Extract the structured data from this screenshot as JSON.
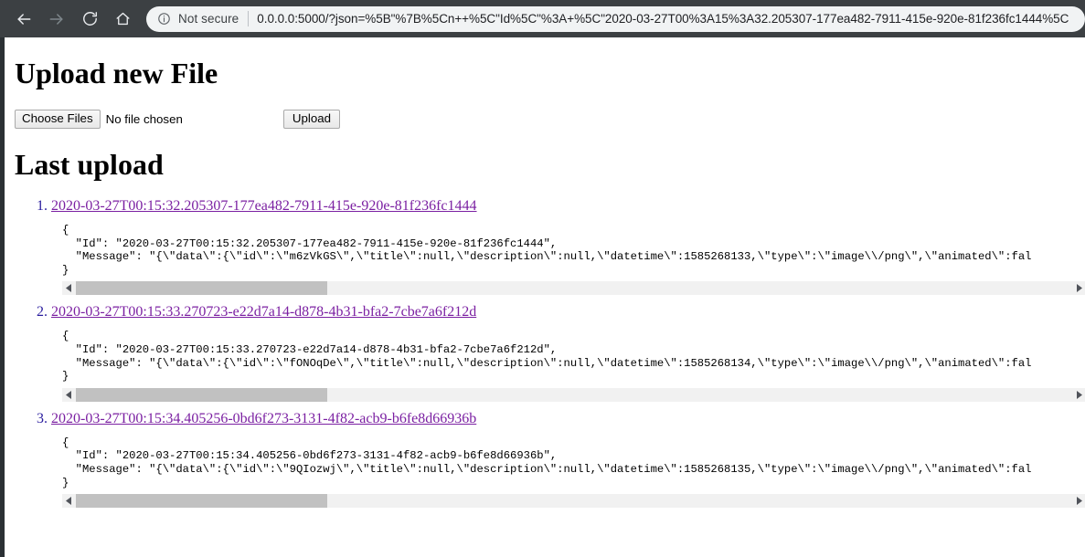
{
  "browser": {
    "back_icon": "back-arrow-icon",
    "forward_icon": "forward-arrow-icon",
    "reload_icon": "reload-icon",
    "home_icon": "home-icon",
    "info_icon": "info-circle-icon",
    "security_label": "Not secure",
    "url": "0.0.0.0:5000/?json=%5B\"%7B%5Cn++%5C\"Id%5C\"%3A+%5C\"2020-03-27T00%3A15%3A32.205307-177ea482-7911-415e-920e-81f236fc1444%5C",
    "chrome_bg": "#3c4043",
    "omnibox_bg": "#f1f3f4"
  },
  "page": {
    "title": "Upload new File",
    "section_title": "Last upload",
    "form": {
      "choose_files_label": "Choose Files",
      "no_file_label": "No file chosen",
      "upload_label": "Upload"
    },
    "link_color": "#7b20a2",
    "uploads": [
      {
        "link": "2020-03-27T00:15:32.205307-177ea482-7911-415e-920e-81f236fc1444",
        "code": "{\n  \"Id\": \"2020-03-27T00:15:32.205307-177ea482-7911-415e-920e-81f236fc1444\",\n  \"Message\": \"{\\\"data\\\":{\\\"id\\\":\\\"m6zVkGS\\\",\\\"title\\\":null,\\\"description\\\":null,\\\"datetime\\\":1585268133,\\\"type\\\":\\\"image\\\\/png\\\",\\\"animated\\\":fal\n}",
        "id_value": "2020-03-27T00:15:32.205307-177ea482-7911-415e-920e-81f236fc1444",
        "imgur_id": "m6zVkGS",
        "datetime": "1585268133",
        "type": "image/png",
        "scroll_thumb_pct": "25.2%"
      },
      {
        "link": "2020-03-27T00:15:33.270723-e22d7a14-d878-4b31-bfa2-7cbe7a6f212d",
        "code": "{\n  \"Id\": \"2020-03-27T00:15:33.270723-e22d7a14-d878-4b31-bfa2-7cbe7a6f212d\",\n  \"Message\": \"{\\\"data\\\":{\\\"id\\\":\\\"fONOqDe\\\",\\\"title\\\":null,\\\"description\\\":null,\\\"datetime\\\":1585268134,\\\"type\\\":\\\"image\\\\/png\\\",\\\"animated\\\":fal\n}",
        "id_value": "2020-03-27T00:15:33.270723-e22d7a14-d878-4b31-bfa2-7cbe7a6f212d",
        "imgur_id": "fONOqDe",
        "datetime": "1585268134",
        "type": "image/png",
        "scroll_thumb_pct": "25.2%"
      },
      {
        "link": "2020-03-27T00:15:34.405256-0bd6f273-3131-4f82-acb9-b6fe8d66936b",
        "code": "{\n  \"Id\": \"2020-03-27T00:15:34.405256-0bd6f273-3131-4f82-acb9-b6fe8d66936b\",\n  \"Message\": \"{\\\"data\\\":{\\\"id\\\":\\\"9QIozwj\\\",\\\"title\\\":null,\\\"description\\\":null,\\\"datetime\\\":1585268135,\\\"type\\\":\\\"image\\\\/png\\\",\\\"animated\\\":fal\n}",
        "id_value": "2020-03-27T00:15:34.405256-0bd6f273-3131-4f82-acb9-b6fe8d66936b",
        "imgur_id": "9QIozwj",
        "datetime": "1585268135",
        "type": "image/png",
        "scroll_thumb_pct": "25.2%"
      }
    ]
  }
}
